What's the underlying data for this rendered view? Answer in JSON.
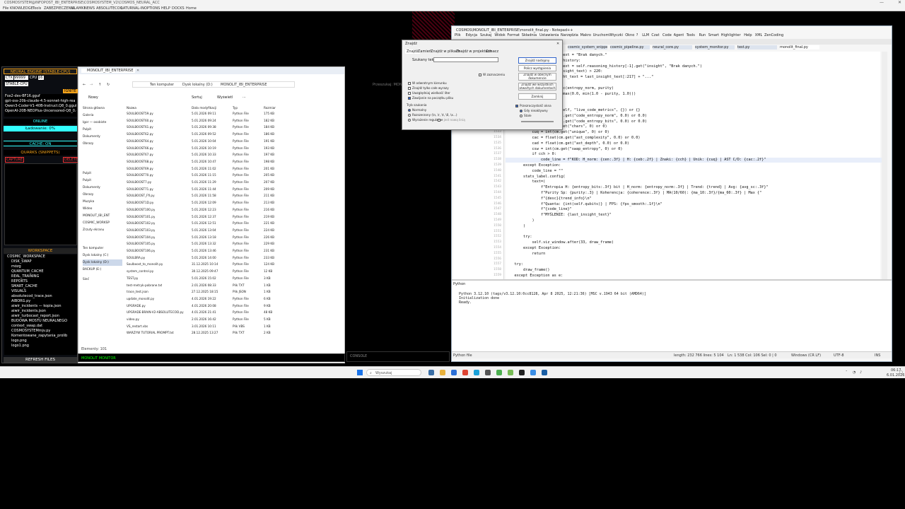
{
  "topbar": {
    "title": "COSMOSYSTEM@INFOPOST_IBI_ENTERPRISE\\COSMOSYSTEM_V2\\COSMOS_NEURAL_ACC",
    "menu": [
      "File",
      "KNOWLEDGE",
      "Tools",
      "ZABEZPIECZENIA",
      "ULAMKI",
      "NEWS",
      "ABSOLUTECOO",
      "LATURNAL-IN",
      "OPTIONS",
      "HELP",
      "DOCKS",
      "Home"
    ]
  },
  "neural": {
    "title": "NEURAL ENGINE [STABLE-CPU]",
    "ctx": "CTX",
    "ctx_val": "99999",
    "cpu": "CPU",
    "cpu_val": "16",
    "stable": "STABLE-CPU",
    "ignite": "IGNITE",
    "models": [
      "Fox2-dev-BF16.gguf",
      "gpt-oss-20b-claude-4.5-sonnet-high-rea",
      "Qwen3-Coder-V1-40B-Instruct.Q8_0.gguf",
      "OpenAI-20B-NEOPlus-Uncensored-Q8_0.gguf"
    ],
    "status": "ONLINE",
    "loading": "Ładowanie: 0%",
    "cache": "CACHE: ON",
    "quarks": "QUARKS (SNIPPETS)",
    "capture": "CAPTURE",
    "delete": "DELETE",
    "workspace": "WORKSPACE",
    "tree": [
      "COSMIC_WORKSPACE",
      "DISK_SWAP",
      "mózg",
      "QUANTUM_CACHE",
      "REAL_TRAINING",
      "REPORTS",
      "SMART_CACHE",
      "VISUALS",
      "absolutecod_trace.json",
      "AIBORG.py",
      "aiwir_incidents — kopia.json",
      "aiwir_incidents.json",
      "aiwir_turbocast_report.json",
      "BUDOWA MOSTU NEURALNEGO",
      "context_swap.dat",
      "COSMOSYSTEMmjv.py",
      "Komentowane_zapytania_prolib",
      "logo.png",
      "logo1.png"
    ],
    "refresh": "REFRESH FILES"
  },
  "explorer": {
    "tab": "MONOLIT_IBI_ENTERPRISE",
    "new": "Nowy",
    "sort": "Sortuj",
    "view": "Wyświetl",
    "path": [
      "Ten komputer",
      "Dysk lokalny (D:)",
      "MONOLIT_IBI_ENTERPRISE"
    ],
    "search_placeholder": "Przeszukaj: MONOLIT_IB...",
    "columns": [
      "Nazwa",
      "Data modyfikacji",
      "Typ",
      "Rozmiar"
    ],
    "nav": [
      "Strona główna",
      "Galeria",
      "Igor — osobiste",
      "Pulpit",
      "Dokumenty",
      "Obrazy",
      "Muzyka",
      "Wideo",
      "MONOLIT_IBI_ENT",
      "COSMIC_WORKSP",
      "Zrzuty ekranu",
      "Ten komputer",
      "Dysk lokalny (C:)",
      "Dysk lokalny (D:)",
      "BACKUP (E:)",
      "Sieć"
    ],
    "files": [
      [
        "SOULBOOST59.py",
        "5.01.2026 09:11",
        "Python File",
        "175 KB"
      ],
      [
        "SOULBOOST60.py",
        "5.01.2026 09:24",
        "Python File",
        "182 KB"
      ],
      [
        "SOULBOOST61.py",
        "5.01.2026 09:38",
        "Python File",
        "184 KB"
      ],
      [
        "SOULBOOST62.py",
        "5.01.2026 09:52",
        "Python File",
        "186 KB"
      ],
      [
        "SOULBOOST64.py",
        "5.01.2026 10:04",
        "Python File",
        "191 KB"
      ],
      [
        "SOULBOOST66.py",
        "5.01.2026 10:19",
        "Python File",
        "193 KB"
      ],
      [
        "SOULBOOST67.py",
        "5.01.2026 10:33",
        "Python File",
        "197 KB"
      ],
      [
        "SOULBOOST68.py",
        "5.01.2026 10:47",
        "Python File",
        "198 KB"
      ],
      [
        "SOULBOOST69.py",
        "5.01.2026 11:02",
        "Python File",
        "201 KB"
      ],
      [
        "SOULBOOST70.py",
        "5.01.2026 11:15",
        "Python File",
        "205 KB"
      ],
      [
        "SOULBOOST7.py",
        "5.01.2026 11:29",
        "Python File",
        "207 KB"
      ],
      [
        "SOULBOOST71.py",
        "5.01.2026 11:44",
        "Python File",
        "209 KB"
      ],
      [
        "SOULBOOST_Ffi.py",
        "5.01.2026 11:58",
        "Python File",
        "211 KB"
      ],
      [
        "SOULBOOST1D.py",
        "5.01.2026 12:09",
        "Python File",
        "213 KB"
      ],
      [
        "SOULBOOST100.py",
        "5.01.2026 12:23",
        "Python File",
        "216 KB"
      ],
      [
        "SOULBOOST101.py",
        "5.01.2026 12:37",
        "Python File",
        "219 KB"
      ],
      [
        "SOULBOOST102.py",
        "5.01.2026 12:51",
        "Python File",
        "221 KB"
      ],
      [
        "SOULBOOST103.py",
        "5.01.2026 13:04",
        "Python File",
        "224 KB"
      ],
      [
        "SOULBOOST104.py",
        "5.01.2026 13:18",
        "Python File",
        "226 KB"
      ],
      [
        "SOULBOOST105.py",
        "5.01.2026 13:32",
        "Python File",
        "229 KB"
      ],
      [
        "SOULBOOST106.py",
        "5.01.2026 13:46",
        "Python File",
        "231 KB"
      ],
      [
        "SOULBRA.py",
        "5.01.2026 14:00",
        "Python File",
        "233 KB"
      ],
      [
        "Soulboost_to_monolit.py",
        "31.12.2025 10:14",
        "Python File",
        "124 KB"
      ],
      [
        "system_control.py",
        "30.12.2025 09:47",
        "Python File",
        "12 KB"
      ],
      [
        "TEST.py",
        "5.01.2026 15:02",
        "Python File",
        "3 KB"
      ],
      [
        "test-metryk-pobrane.txt",
        "2.01.2026 08:33",
        "Plik TXT",
        "1 KB"
      ],
      [
        "trace_test.json",
        "27.12.2025 18:15",
        "Plik JSON",
        "1 KB"
      ],
      [
        "update_monolit.py",
        "4.01.2026 19:22",
        "Python File",
        "6 KB"
      ],
      [
        "UPGRADE.py",
        "4.01.2026 20:08",
        "Python File",
        "9 KB"
      ],
      [
        "UPGRADE-BRAIN-V2-ABSOLUTECOD.py",
        "4.01.2026 21:41",
        "Python File",
        "48 KB"
      ],
      [
        "video.py",
        "2.01.2026 16:42",
        "Python File",
        "5 KB"
      ],
      [
        "VS_restart.vbs",
        "3.01.2026 10:11",
        "Plik VBS",
        "1 KB"
      ],
      [
        "WARZYW TUTORIAL PROMPT.txt",
        "28.12.2025 13:27",
        "Plik TXT",
        "2 KB"
      ]
    ],
    "status": "Elementy: 101"
  },
  "editor": {
    "title": "COSMOS\\MONOLIT_IBI_ENTERPRISE\\monolit_final.py - Notepad++",
    "menu": [
      "Plik",
      "Edycja",
      "Szukaj",
      "Widok",
      "Format",
      "Składnia",
      "Ustawienia",
      "Narzędzia",
      "Makro",
      "Uruchom",
      "Wtyczki",
      "Okno",
      "?",
      "LLM",
      "Czat",
      "Code",
      "Agent",
      "Tools",
      "Run",
      "Smart",
      "Highlighter",
      "Help",
      "XML",
      "ZenCoding"
    ],
    "tabs": [
      "cosmic_system_snippets.py",
      "cosmic_pipeline.py",
      "neural_core.py",
      "system_monitor.py",
      "test.py",
      "monolit_final.py"
    ],
    "code": [
      [
        "1519",
        "            last_insight_text = \"Brak danych.\""
      ],
      [
        "1520",
        "        if self.reasoning_history:"
      ],
      [
        "1521",
        "            last_insight_text = self.reasoning_history[-1].get(\"insight\", \"Brak danych.\")"
      ],
      [
        "1522",
        "            if len(last_insight_text) > 220:"
      ],
      [
        "1523",
        "                last_insight_text = last_insight_text[:217] + \"...\""
      ],
      [
        "1524",
        ""
      ],
      [
        "1525",
        "        desc = entropy_desc(entropy_norm, purity)"
      ],
      [
        "1526",
        "        coherence = float(max(0.0, min(1.0 - purity, 1.0)))"
      ],
      [
        "1527",
        "        code_line = \"\""
      ],
      [
        "1528",
        "        try:"
      ],
      [
        "1529",
        "            cm = getattr(self, \"live_code_metrics\", {}) or {}"
      ],
      [
        "1530",
        "            cen = float(cm.get(\"code_entropy_norm\", 0.0) or 0.0)"
      ],
      [
        "1531",
        "            ceb = float(cm.get(\"code_entropy_bits\", 0.0) or 0.0)"
      ],
      [
        "1532",
        "            cch = int(cm.get(\"chars\", 0) or 0)"
      ],
      [
        "1533",
        "            cuq = int(cm.get(\"unique\", 0) or 0)"
      ],
      [
        "1534",
        "            cac = float(cm.get(\"ast_complexity\", 0.0) or 0.0)"
      ],
      [
        "1535",
        "            cad = float(cm.get(\"ast_depth\", 0.0) or 0.0)"
      ],
      [
        "1536",
        "            csw = int(cm.get(\"swap_entropy\", 0) or 0)"
      ],
      [
        "1537",
        "            if cch > 0:"
      ],
      [
        "1538",
        "                code_line = f\"KOD: H_norm: {cen:.3f} | H: {ceb:.2f} | Znaki: {cch} | Unik: {cuq} | AST C/D: {cac:.2f}\""
      ],
      [
        "1539",
        "        except Exception:"
      ],
      [
        "1540",
        "            code_line = \"\""
      ],
      [
        "1541",
        "        stats_label.config("
      ],
      [
        "1542",
        "            text=("
      ],
      [
        "1543",
        "                f\"Entropia H: {entropy_bits:.3f} bit | H_norm: {entropy_norm:.3f} | Trend: {trend} | Avg: {avg_sc:.3f}\""
      ],
      [
        "1544",
        "                f\"Purity Sp: {purity:.3} | Koherencja: {coherence:.3f} | MA(10/60): {ma_10:.3f}/{ma_60:.3f} | Max {\""
      ],
      [
        "1545",
        "                f\"{desc}{trend_info}\\n\""
      ],
      [
        "1546",
        "                f\"Quanta: {int(self.qubits)} | FPS: {fps_smooth:.1f}\\n\""
      ],
      [
        "1547",
        "                f\"{code_line}\""
      ],
      [
        "1548",
        "                f\"MYŚLENIE: {last_insight_text}\""
      ],
      [
        "1549",
        "            )"
      ],
      [
        "1550",
        "        )"
      ],
      [
        "1551",
        ""
      ],
      [
        "1552",
        "        try:"
      ],
      [
        "1553",
        "            self.viz_window.after(33, draw_frame)"
      ],
      [
        "1554",
        "        except Exception:"
      ],
      [
        "1555",
        "            return"
      ],
      [
        "1556",
        ""
      ],
      [
        "1557",
        "    try:"
      ],
      [
        "1558",
        "        draw_frame()"
      ],
      [
        "1559",
        "    except Exception as e:"
      ]
    ],
    "console_tab": "Python",
    "console": [
      "Python 3.12.10 (tags/v3.12.10:0cc8128, Apr  8 2025, 12:21:36) [MSC v.1943 64 bit (AMD64)]",
      "Initialization done",
      "Ready."
    ],
    "status_left": "Python file",
    "status_len": "length: 232 766   lines: 5 104",
    "status_pos": "Ln: 1 538   Col: 106   Sel: 0 | 0",
    "status_eol": "Windows (CR LF)",
    "status_enc": "UTF-8",
    "status_ins": "INS"
  },
  "dialog": {
    "title": "Znajdź",
    "tabs": [
      "Znajdź",
      "Zamień",
      "Znajdź w plikach",
      "Znajdź w projektach",
      "Oznacz"
    ],
    "find_label": "Szukany tekst:",
    "find_value": "",
    "buttons": [
      "Znajdź następny",
      "Policz wystąpienia",
      "Znajdź w obecnym dokumencie",
      "Znajdź we wszystkich otwartych dokumentach",
      "Zamknij"
    ],
    "in_selection": "W zaznaczeniu",
    "options": [
      "W odwrotnym kierunku",
      "Znajdź tylko całe wyrazy",
      "Uwzględniaj wielkość liter",
      "Zawijanie na początku pliku"
    ],
    "mode_label": "Tryb szukania",
    "modes": [
      "Normalny",
      "Rozszerzony (\\n, \\r, \\t, \\0, \\x...)",
      "Wyrażenie regularne"
    ],
    "dotnl": ". jest nową linią",
    "transparency_label": "Przezroczystość okna",
    "trans_modes": [
      "Gdy nieaktywny",
      "Stale"
    ]
  },
  "taskbar": {
    "search_placeholder": "Wyszukaj",
    "time": "06:17",
    "date": "6.01.2026"
  },
  "bottom_bar": {
    "left": "MONOLIT MONITOR",
    "right": "CONSOLE"
  }
}
